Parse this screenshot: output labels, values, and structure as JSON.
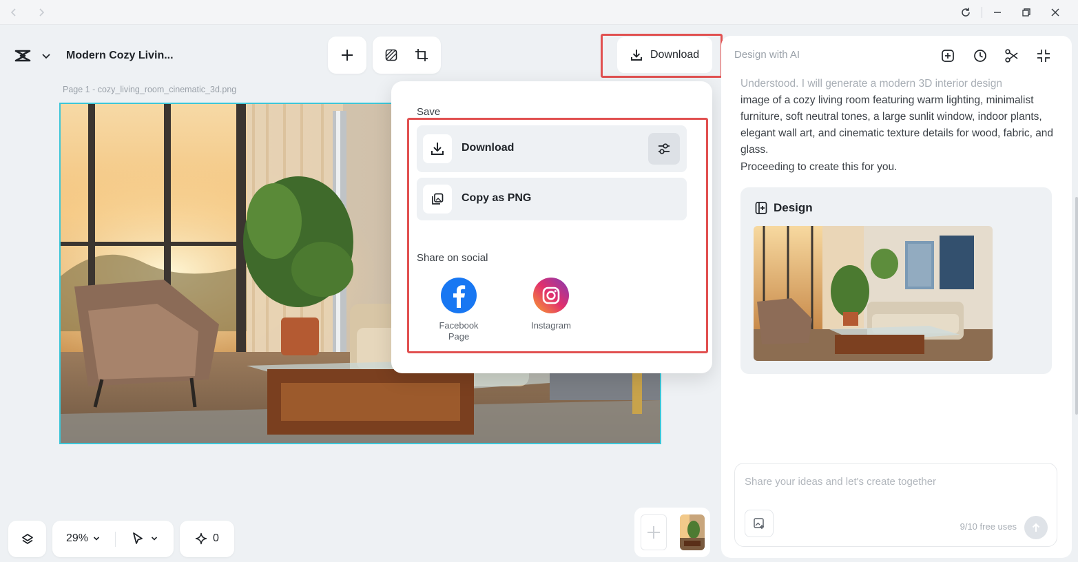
{
  "titlebar": {
    "back_icon": "chevron-left-icon",
    "forward_icon": "chevron-right-icon",
    "refresh_icon": "refresh-icon",
    "minimize_icon": "minimize-icon",
    "restore_icon": "restore-icon",
    "close_icon": "close-icon"
  },
  "project": {
    "title": "Modern Cozy Livin..."
  },
  "toolbar": {
    "add_icon": "plus-icon",
    "background_icon": "background-hatch-icon",
    "resize_icon": "resize-icon"
  },
  "canvas": {
    "page_label": "Page 1 -  cozy_living_room_cinematic_3d.png"
  },
  "download_button": {
    "label": "Download"
  },
  "menu": {
    "save_label": "Save",
    "download_label": "Download",
    "copy_label": "Copy as PNG",
    "share_label": "Share on social",
    "social": [
      {
        "name": "Facebook Page",
        "line1": "Facebook",
        "line2": "Page",
        "color": "#1877f2"
      },
      {
        "name": "Instagram",
        "line1": "Instagram",
        "line2": "",
        "color": "#d6249f"
      }
    ]
  },
  "right_panel": {
    "title": "Design with AI",
    "message_faded": "Understood. I will generate a modern 3D interior design",
    "message": "image of a cozy living room featuring warm lighting, minimalist furniture, soft neutral tones, a large sunlit window, indoor plants, elegant wall art, and cinematic texture details for wood, fabric, and glass.",
    "message2": "Proceeding to create this for you.",
    "design_title": "Design",
    "prompt_placeholder": "Share your ideas and let's create together",
    "free_uses": "9/10 free uses"
  },
  "bottom": {
    "zoom": "29%",
    "credits": "0"
  },
  "colors": {
    "accent_cyan": "#3cc6d8",
    "highlight_red": "#e15050",
    "facebook_blue": "#1877f2"
  }
}
